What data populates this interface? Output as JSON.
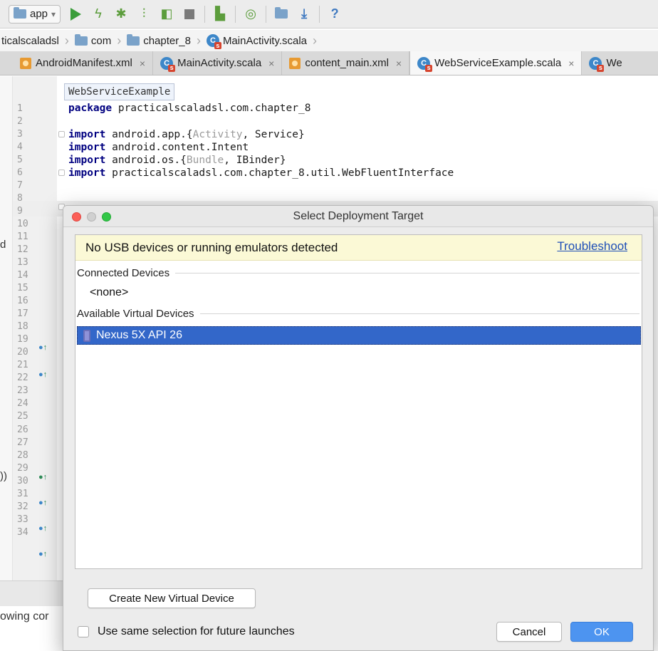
{
  "toolbar": {
    "run_config": "app",
    "dropdown_glyph": "▾",
    "help_glyph": "?"
  },
  "breadcrumb": [
    "ticalscaladsl",
    "com",
    "chapter_8",
    "MainActivity.scala"
  ],
  "tabs": [
    {
      "label": "AndroidManifest.xml",
      "icon": "xml-file-icon",
      "active": false
    },
    {
      "label": "MainActivity.scala",
      "icon": "scala-file-icon",
      "active": false
    },
    {
      "label": "content_main.xml",
      "icon": "layout-file-icon",
      "active": false
    },
    {
      "label": "WebServiceExample.scala",
      "icon": "scala-file-icon",
      "active": true
    },
    {
      "label": "We",
      "icon": "scala-file-icon",
      "active": false
    }
  ],
  "tab_close_glyph": "×",
  "editor": {
    "tooltip": "WebServiceExample",
    "line_numbers": [
      "1",
      "2",
      "3",
      "4",
      "5",
      "6",
      "7",
      "8",
      "9",
      "10",
      "11",
      "12",
      "13",
      "14",
      "15",
      "16",
      "17",
      "18",
      "19",
      "20",
      "21",
      "22",
      "23",
      "24",
      "25",
      "26",
      "27",
      "28",
      "29",
      "30",
      "31",
      "32",
      "33",
      "34"
    ],
    "code": {
      "l1_kw": "package",
      "l1_rest": " practicalscaladsl.com.chapter_8",
      "l3_kw": "import",
      "l3_a": " android.app.{",
      "l3_dim": "Activity",
      "l3_b": ", Service}",
      "l4_kw": "import",
      "l4_rest": " android.content.Intent",
      "l5_kw": "import",
      "l5_a": " android.os.{",
      "l5_dim": "Bundle",
      "l5_b": ", IBinder}",
      "l6_kw": "import",
      "l6_rest": " practicalscaladsl.com.chapter_8.util.WebFluentInterface"
    },
    "left_clips": [
      "d",
      "))"
    ],
    "bottom_left_text": "owing cor"
  },
  "dialog": {
    "title": "Select Deployment Target",
    "warning": "No USB devices or running emulators detected",
    "troubleshoot": "Troubleshoot",
    "connected_section": "Connected Devices",
    "connected_none": "<none>",
    "available_section": "Available Virtual Devices",
    "selected_device": "Nexus 5X API 26",
    "create_button": "Create New Virtual Device",
    "checkbox_label": "Use same selection for future launches",
    "cancel_button": "Cancel",
    "ok_button": "OK"
  },
  "colors": {
    "selection": "#3367c9",
    "ok_button": "#4d94f0",
    "warning_bg": "#fbf9d6",
    "link": "#1f4fb7"
  }
}
